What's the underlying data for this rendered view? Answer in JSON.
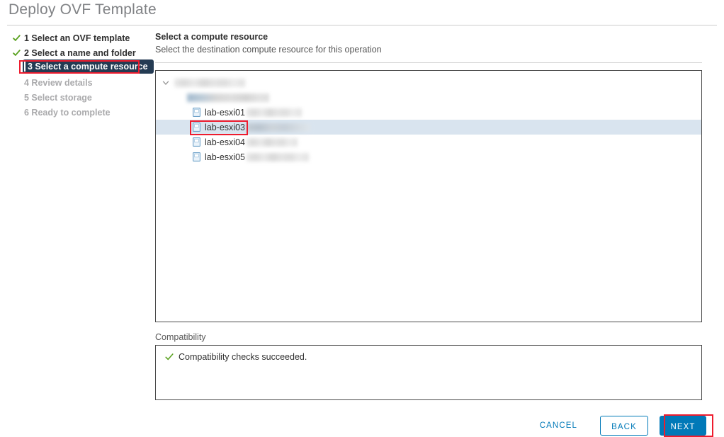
{
  "window": {
    "title": "Deploy OVF Template"
  },
  "steps": [
    {
      "number": "1",
      "label": "1 Select an OVF template",
      "state": "done"
    },
    {
      "number": "2",
      "label": "2 Select a name and folder",
      "state": "done"
    },
    {
      "number": "3",
      "label": "3 Select a compute resource",
      "state": "active"
    },
    {
      "number": "4",
      "label": "4 Review details",
      "state": "todo"
    },
    {
      "number": "5",
      "label": "5 Select storage",
      "state": "todo"
    },
    {
      "number": "6",
      "label": "6 Ready to complete",
      "state": "todo"
    }
  ],
  "pane": {
    "title": "Select a compute resource",
    "subtitle": "Select the destination compute resource for this operation"
  },
  "tree": {
    "datacenter": {
      "name_redacted": true,
      "icon": "datacenter-icon",
      "expanded": true
    },
    "cluster": {
      "name_redacted": true,
      "icon": "cluster-icon"
    },
    "hosts": [
      {
        "name": "lab-esxi01",
        "suffix_redacted": true,
        "selected": false,
        "icon": "host-icon"
      },
      {
        "name": "lab-esxi03",
        "suffix_redacted": true,
        "selected": true,
        "icon": "host-icon"
      },
      {
        "name": "lab-esxi04",
        "suffix_redacted": true,
        "selected": false,
        "icon": "host-icon"
      },
      {
        "name": "lab-esxi05",
        "suffix_redacted": true,
        "selected": false,
        "icon": "host-icon"
      }
    ]
  },
  "compatibility": {
    "label": "Compatibility",
    "message": "Compatibility checks succeeded."
  },
  "footer": {
    "cancel_label": "CANCEL",
    "back_label": "BACK",
    "next_label": "NEXT"
  },
  "colors": {
    "accent_blue": "#0079b8",
    "active_step_bg": "#243b53",
    "annotation_red": "#ee1c2e",
    "success_green": "#5aa220",
    "selected_row": "#d9e4ef"
  }
}
